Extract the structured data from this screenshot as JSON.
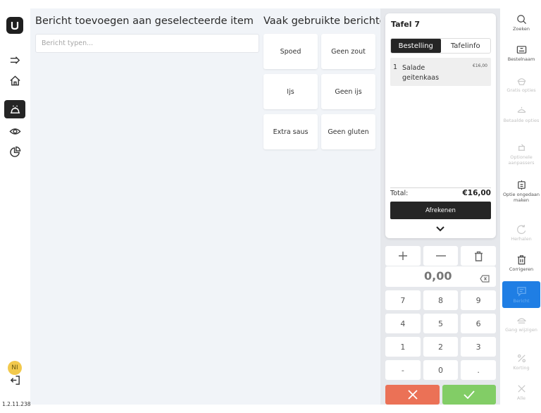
{
  "app": {
    "version": "1.2.11.238",
    "user_initials": "NI"
  },
  "nav": {
    "icons": [
      "logo-icon",
      "collapse-icon",
      "home-icon",
      "service-bell-icon",
      "eye-icon",
      "pie-chart-icon",
      "logout-icon"
    ]
  },
  "message": {
    "title": "Bericht toevoegen aan geselecteerde item",
    "input_placeholder": "Bericht typen...",
    "input_value": ""
  },
  "frequent": {
    "title": "Vaak gebruikte berichten",
    "buttons": [
      "Spoed",
      "Geen zout",
      "Ijs",
      "Geen ijs",
      "Extra saus",
      "Geen gluten"
    ]
  },
  "order": {
    "table_name": "Tafel 7",
    "tabs": [
      {
        "label": "Bestelling",
        "active": true
      },
      {
        "label": "Tafelinfo",
        "active": false
      }
    ],
    "lines": [
      {
        "qty": "1",
        "name": "Salade geitenkaas",
        "price": "€16,00"
      }
    ],
    "total_label": "Total:",
    "total_value": "€16,00",
    "pay_label": "Afrekenen"
  },
  "keypad": {
    "amount": "0,00",
    "rows": [
      [
        "7",
        "8",
        "9"
      ],
      [
        "4",
        "5",
        "6"
      ],
      [
        "1",
        "2",
        "3"
      ],
      [
        "-",
        "0",
        "."
      ]
    ]
  },
  "actions": [
    {
      "id": "zoeken",
      "label": "Zoeken",
      "icon": "search-icon",
      "state": "enabled"
    },
    {
      "id": "bestelnaam",
      "label": "Bestelnaam",
      "icon": "name-tag-icon",
      "state": "enabled"
    },
    {
      "id": "gratis",
      "label": "Gratis opties",
      "icon": "gift-icon",
      "state": "disabled"
    },
    {
      "id": "betaalde",
      "label": "Betaalde opties",
      "icon": "paid-option-icon",
      "state": "disabled"
    },
    {
      "id": "optionele",
      "label": "Optionele aanpassers",
      "icon": "modifier-icon",
      "state": "disabled"
    },
    {
      "id": "ongedaan",
      "label": "Optie ongedaan maken",
      "icon": "undo-option-icon",
      "state": "enabled"
    },
    {
      "id": "herhalen",
      "label": "Herhalen",
      "icon": "repeat-icon",
      "state": "disabled"
    },
    {
      "id": "corrigeren",
      "label": "Corrigeren",
      "icon": "trash-icon",
      "state": "enabled"
    },
    {
      "id": "bericht",
      "label": "Bericht",
      "icon": "message-icon",
      "state": "selected"
    },
    {
      "id": "gang",
      "label": "Gang wijzigen",
      "icon": "course-icon",
      "state": "disabled"
    },
    {
      "id": "korting",
      "label": "Korting",
      "icon": "percent-icon",
      "state": "disabled"
    },
    {
      "id": "alle",
      "label": "Alle",
      "icon": "close-icon",
      "state": "disabled"
    }
  ],
  "colors": {
    "cancel": "#eb7156",
    "confirm": "#82cd66",
    "selected_action": "#1f7ee4",
    "dark": "#252525"
  }
}
